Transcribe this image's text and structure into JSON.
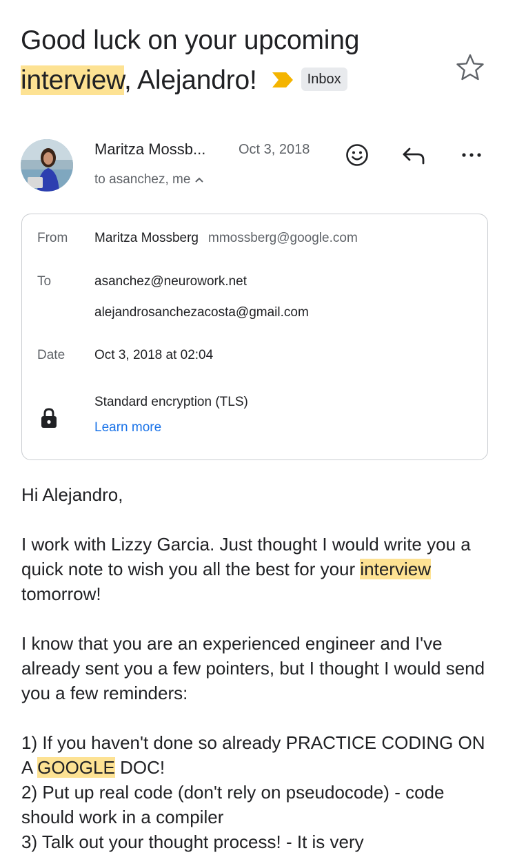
{
  "subject": {
    "part1": "Good luck on your upcoming ",
    "highlight": "interview",
    "part2": ", Alejandro!",
    "label": "Inbox",
    "importance_color": "#f4b400",
    "star_icon": "star-outline-icon"
  },
  "sender": {
    "name": "Maritza Mossb...",
    "date": "Oct 3, 2018",
    "recipients": "to asanchez, me",
    "actions": [
      "smiley-icon",
      "reply-icon",
      "more-icon"
    ]
  },
  "details": {
    "from_label": "From",
    "from_name": "Maritza Mossberg",
    "from_email": "mmossberg@google.com",
    "to_label": "To",
    "to_email_1": "asanchez@neurowork.net",
    "to_email_2": "alejandrosanchezacosta@gmail.com",
    "date_label": "Date",
    "date_value": "Oct 3, 2018 at 02:04",
    "security": "Standard encryption (TLS)",
    "learn_more": "Learn more"
  },
  "body": {
    "greeting": "Hi Alejandro,",
    "p1_a": "I work with Lizzy Garcia. Just thought I would write you a quick note to wish you all the best for your ",
    "p1_hl": "interview",
    "p1_b": " tomorrow!",
    "p2": "I know that you are an experienced engineer and I've already sent you a few pointers, but I thought I would send you a few reminders:",
    "l1_a": "1) If you haven't done so already PRACTICE CODING ON A ",
    "l1_hl": "GOOGLE",
    "l1_b": " DOC!",
    "l2": "2) Put up real code (don't rely on pseudocode) - code should work in a compiler",
    "l3": "3) Talk out your thought process! - It is very"
  }
}
